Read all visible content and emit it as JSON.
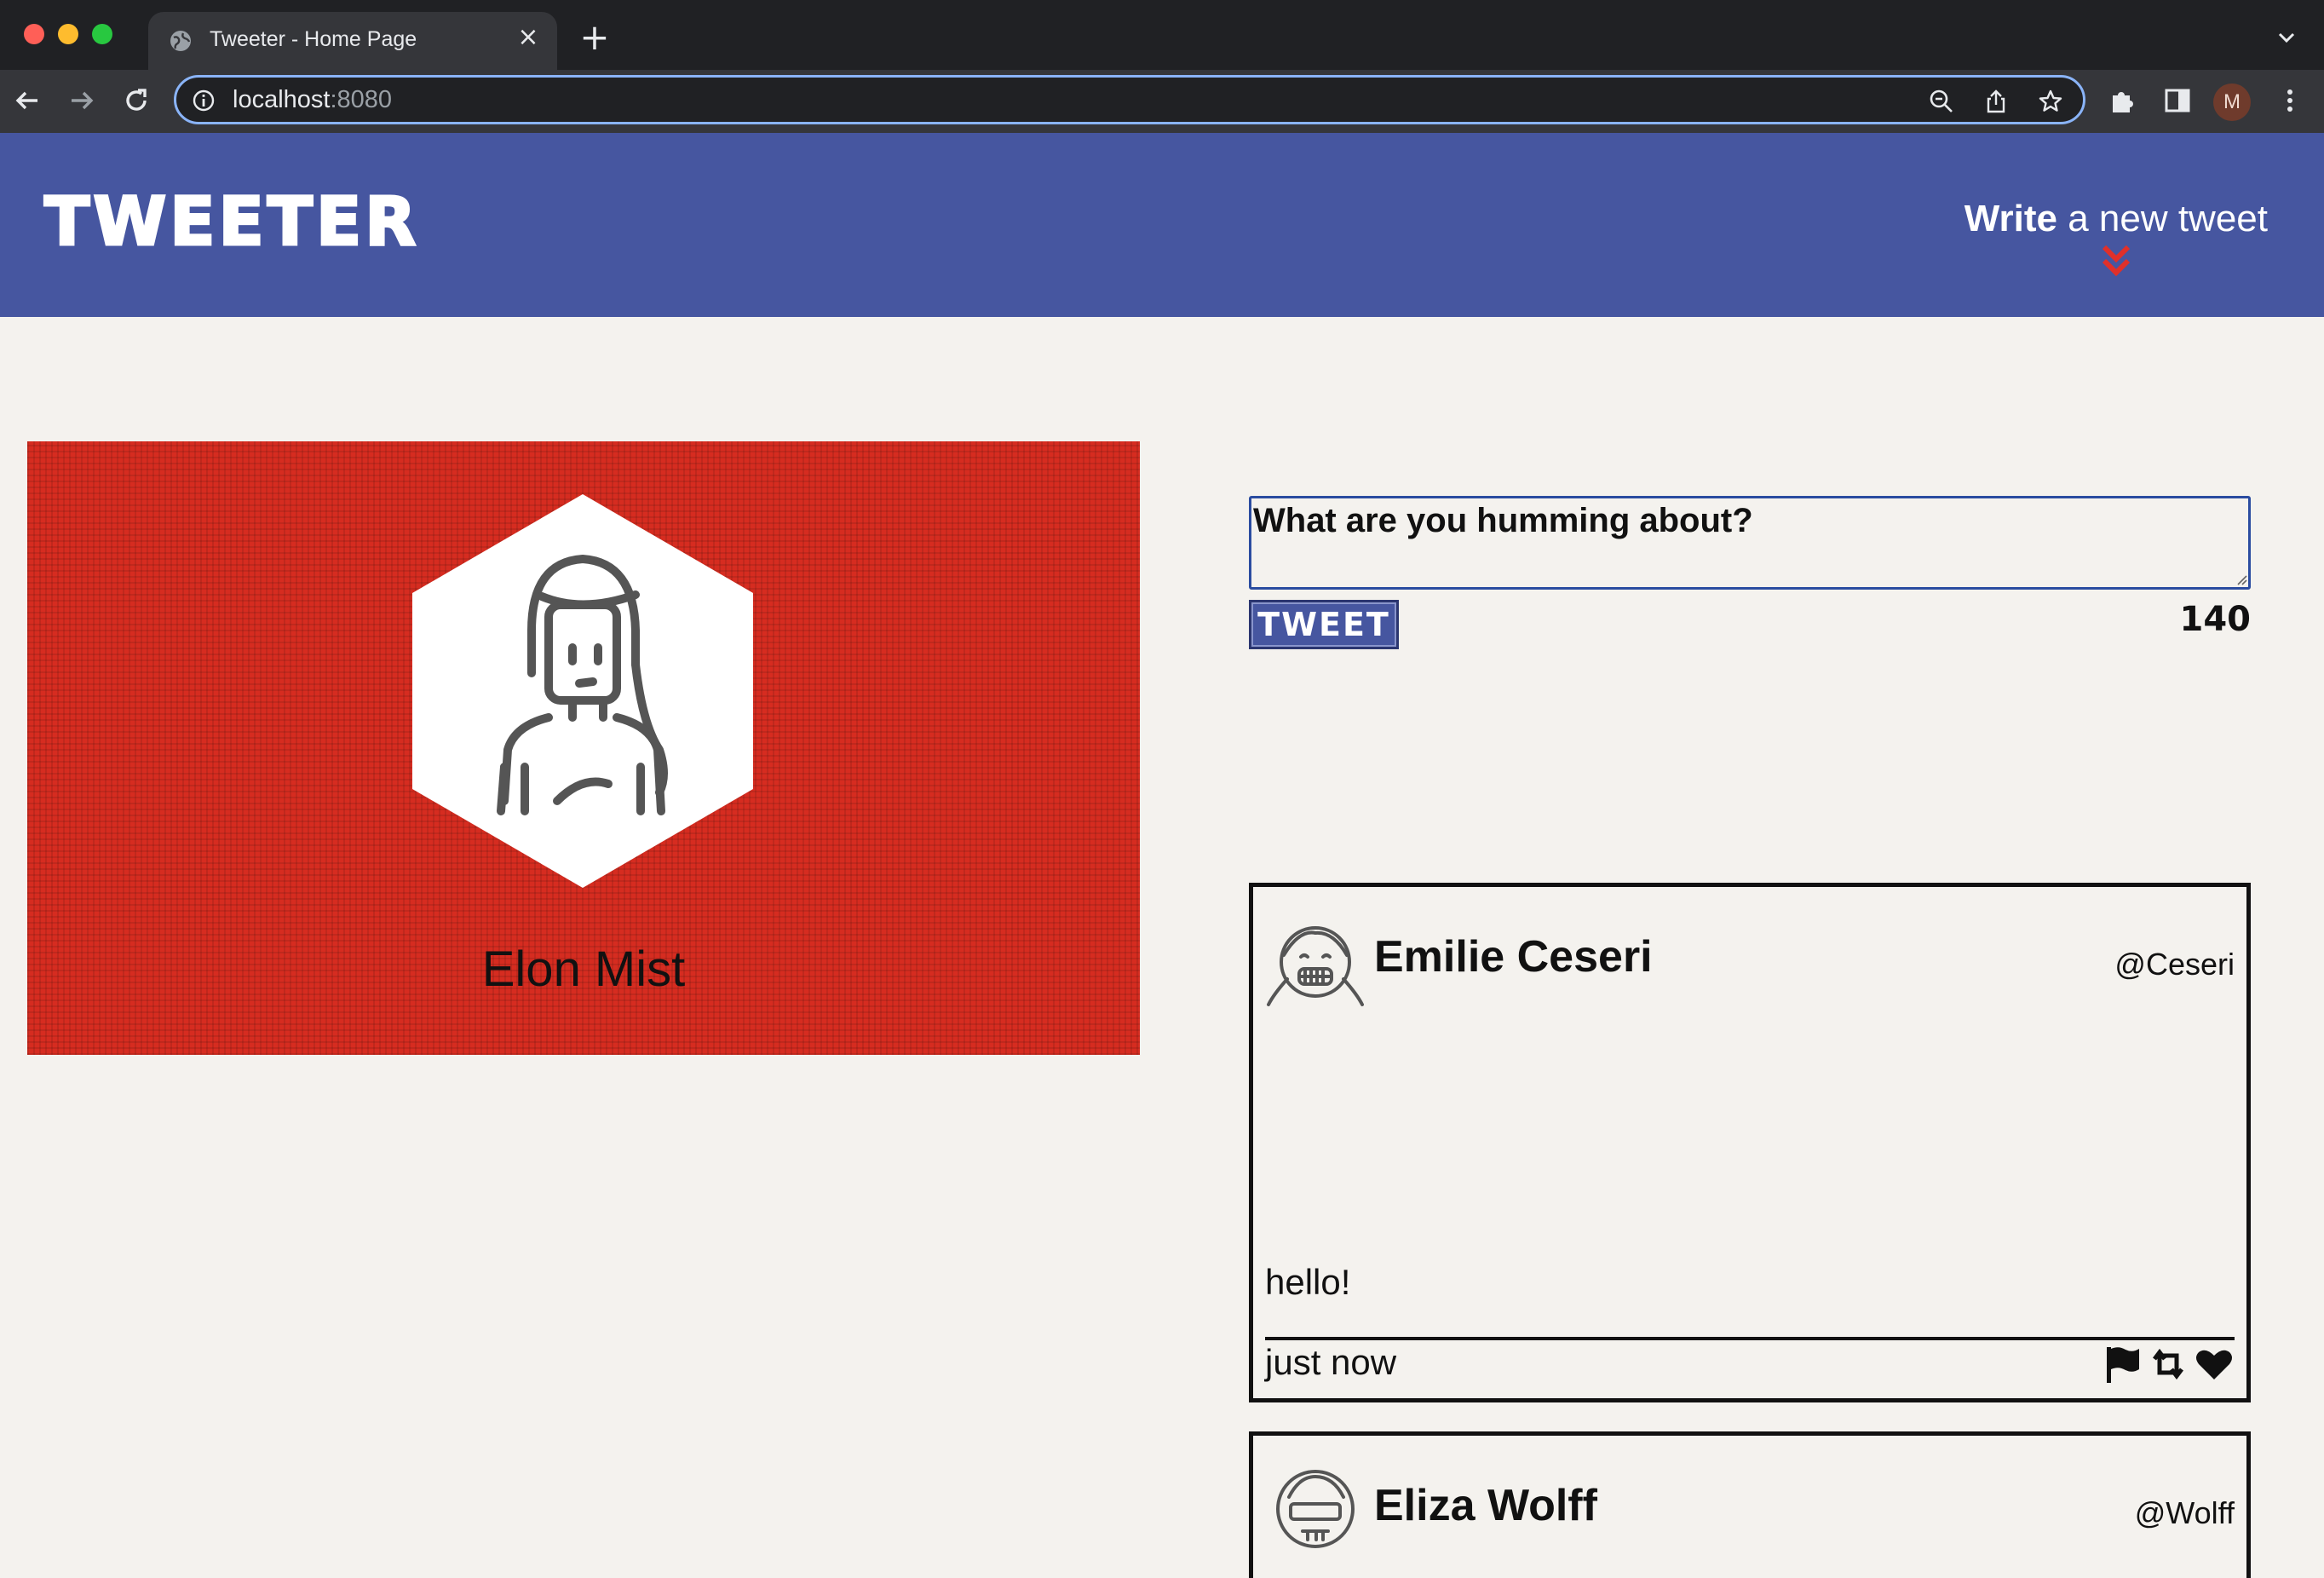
{
  "browser": {
    "tab_title": "Tweeter - Home Page",
    "tab_close": "×",
    "new_tab": "+",
    "url_host": "localhost",
    "url_port": ":8080",
    "profile_initial": "M"
  },
  "header": {
    "logo": "TWEETER",
    "compose_strong": "Write",
    "compose_rest": " a new tweet"
  },
  "profile": {
    "name": "Elon Mist"
  },
  "composer": {
    "placeholder": "What are you humming about?",
    "button_label": "TWEET",
    "char_count": "140"
  },
  "tweets": [
    {
      "name": "Emilie Ceseri",
      "handle": "@Ceseri",
      "text": "hello!",
      "time": "just now"
    },
    {
      "name": "Eliza Wolff",
      "handle": "@Wolff"
    }
  ],
  "colors": {
    "header_bg": "#4656a0",
    "profile_bg": "#d62c20",
    "page_bg": "#f4f2ee",
    "accent_arrow": "#e0302a"
  },
  "icons": {
    "tab_favicon": "globe-icon",
    "back": "arrow-left-icon",
    "forward": "arrow-right-icon",
    "reload": "reload-icon",
    "site_info": "info-icon",
    "zoom": "zoom-out-icon",
    "share": "share-icon",
    "bookmark": "star-icon",
    "extensions": "puzzle-icon",
    "side_panel": "side-panel-icon",
    "menu": "kebab-menu-icon",
    "compose_arrow": "double-chevron-down-icon",
    "flag": "flag-icon",
    "retweet": "retweet-icon",
    "like": "heart-icon"
  }
}
